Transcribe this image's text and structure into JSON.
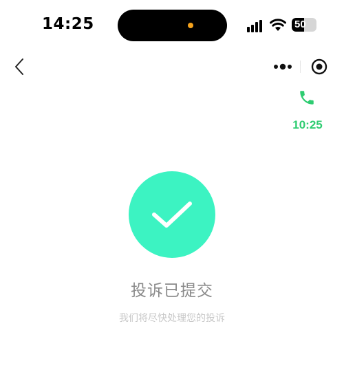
{
  "status_bar": {
    "time": "14:25",
    "battery_level": "50",
    "battery_fraction": 0.5
  },
  "nav": {
    "back_icon": "chevron-left-icon",
    "more_icon": "more-dots-icon",
    "close_icon": "target-circle-icon"
  },
  "call": {
    "icon": "phone-icon",
    "duration": "10:25",
    "color": "#2ecc71"
  },
  "result": {
    "icon": "checkmark-icon",
    "accent": "#3cf3c2",
    "title": "投诉已提交",
    "subtitle": "我们将尽快处理您的投诉"
  }
}
